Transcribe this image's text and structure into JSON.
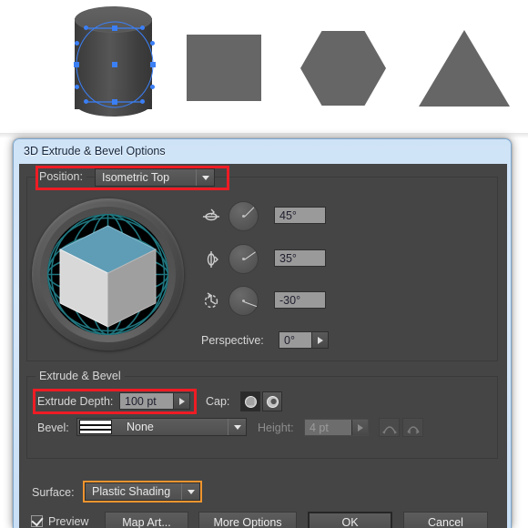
{
  "artboard": {
    "shapes": [
      {
        "name": "extruded-cylinder",
        "label": "3D extruded cylinder with selected circle path",
        "fill": "#4e4e4e"
      },
      {
        "name": "square",
        "label": "Square",
        "fill": "#666666"
      },
      {
        "name": "hexagon",
        "label": "Hexagon",
        "fill": "#666666"
      },
      {
        "name": "triangle",
        "label": "Triangle",
        "fill": "#666666"
      }
    ],
    "selection_color": "#3b7ff5"
  },
  "dialog": {
    "title": "3D Extrude & Bevel Options",
    "position_group": {
      "label": "Position:",
      "preset": "Isometric Top",
      "highlight_color": "#ee1c24",
      "rotation": [
        {
          "axis": "x-axis",
          "icon": "rotate-x-icon",
          "value": "45°",
          "degrees": 45
        },
        {
          "axis": "y-axis",
          "icon": "rotate-y-icon",
          "value": "35°",
          "degrees": 35
        },
        {
          "axis": "z-axis",
          "icon": "rotate-z-icon",
          "value": "-30°",
          "degrees": -30
        }
      ],
      "perspective": {
        "label": "Perspective:",
        "value": "0°"
      },
      "cube_widget": {
        "top_face_color": "#5f9cb5",
        "left_face_color": "#d8d8d8",
        "right_face_color": "#9f9f9f",
        "grid_color": "#1f6f78",
        "background": "#000000"
      }
    },
    "extrude_group": {
      "legend": "Extrude & Bevel",
      "extrude_depth": {
        "label": "Extrude Depth:",
        "value": "100 pt",
        "highlight_color": "#ee1c24"
      },
      "cap": {
        "label": "Cap:",
        "options": [
          "solid-cap",
          "hollow-cap"
        ],
        "selected": "solid-cap"
      },
      "bevel": {
        "label": "Bevel:",
        "value": "None",
        "swatch": "bevel-none-swatch"
      },
      "height": {
        "label": "Height:",
        "value": "4 pt",
        "enabled": false
      },
      "bevel_extent": [
        {
          "name": "bevel-extent-out-button",
          "enabled": false
        },
        {
          "name": "bevel-extent-in-button",
          "enabled": false
        }
      ]
    },
    "surface": {
      "label": "Surface:",
      "value": "Plastic Shading",
      "focus_color": "#f0952e"
    },
    "footer": {
      "preview": {
        "label": "Preview",
        "checked": true
      },
      "buttons": [
        {
          "name": "map-art-button",
          "label": "Map Art..."
        },
        {
          "name": "more-options-button",
          "label": "More Options"
        },
        {
          "name": "ok-button",
          "label": "OK",
          "default": true
        },
        {
          "name": "cancel-button",
          "label": "Cancel"
        }
      ]
    }
  }
}
